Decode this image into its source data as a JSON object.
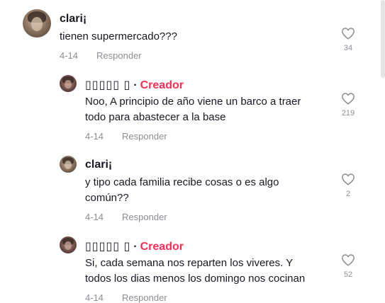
{
  "comments": [
    {
      "username": "clari¡",
      "text_lines": [
        "tienen supermercado???"
      ],
      "date": "4-14",
      "reply_label": "Responder",
      "likes": "34"
    },
    {
      "username": "▯▯▯▯▯ ▯",
      "creator_badge": "Creador",
      "separator": "·",
      "text_lines": [
        "Noo, A principio de año viene un barco a traer",
        "todo para abastecer a la base"
      ],
      "date": "4-14",
      "reply_label": "Responder",
      "likes": "219"
    },
    {
      "username": "clari¡",
      "text_lines": [
        "y tipo cada familia recibe cosas o es algo",
        "común??"
      ],
      "date": "4-14",
      "reply_label": "Responder",
      "likes": "2"
    },
    {
      "username": "▯▯▯▯▯ ▯",
      "creator_badge": "Creador",
      "separator": "·",
      "text_lines": [
        "Si, cada semana nos reparten los viveres. Y",
        "todos los dias menos los domingo nos cocinan"
      ],
      "date": "4-14",
      "reply_label": "Responder",
      "likes": "52"
    }
  ],
  "colors": {
    "creator_badge": "#fe2c55",
    "text": "#161823",
    "muted": "#8a8b91"
  },
  "icons": {
    "like": "heart-outline-icon"
  }
}
